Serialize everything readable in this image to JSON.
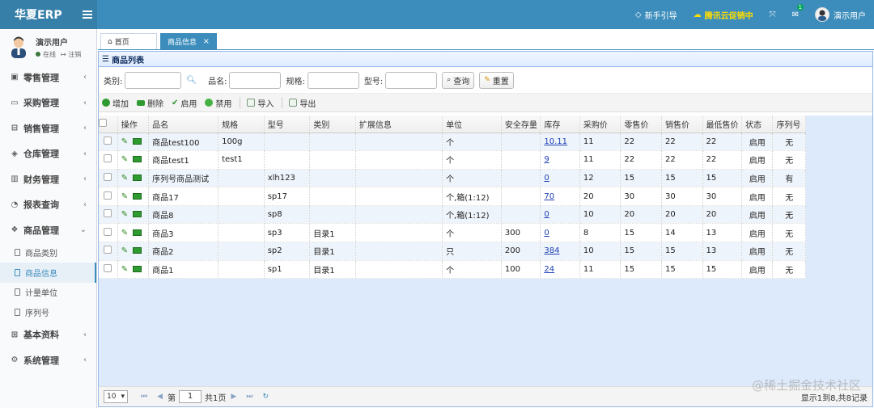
{
  "app": {
    "logo": "华夏ERP"
  },
  "topbar": {
    "guide": "新手引导",
    "promo": "腾讯云促销中",
    "mail_badge": "1",
    "user": "演示用户"
  },
  "sidebar": {
    "user_name": "演示用户",
    "status_online": "在线",
    "status_logout": "注销",
    "items": [
      {
        "label": "零售管理",
        "icon": "retail-icon"
      },
      {
        "label": "采购管理",
        "icon": "purchase-icon"
      },
      {
        "label": "销售管理",
        "icon": "sales-icon"
      },
      {
        "label": "仓库管理",
        "icon": "warehouse-icon"
      },
      {
        "label": "财务管理",
        "icon": "finance-icon"
      },
      {
        "label": "报表查询",
        "icon": "report-icon"
      },
      {
        "label": "商品管理",
        "icon": "goods-icon"
      }
    ],
    "subitems": [
      {
        "label": "商品类别"
      },
      {
        "label": "商品信息"
      },
      {
        "label": "计量单位"
      },
      {
        "label": "序列号"
      }
    ],
    "items_bottom": [
      {
        "label": "基本资料",
        "icon": "basic-icon"
      },
      {
        "label": "系统管理",
        "icon": "system-icon"
      }
    ]
  },
  "tabs": {
    "home": "首页",
    "active": "商品信息"
  },
  "panel": {
    "title": "商品列表"
  },
  "search": {
    "category_label": "类别:",
    "name_label": "品名:",
    "spec_label": "规格:",
    "model_label": "型号:",
    "query_button": "查询",
    "reset_button": "重置"
  },
  "toolbar": {
    "add": "增加",
    "delete": "删除",
    "enable": "启用",
    "disable": "禁用",
    "import": "导入",
    "export": "导出"
  },
  "table": {
    "headers": [
      "操作",
      "品名",
      "规格",
      "型号",
      "类别",
      "扩展信息",
      "单位",
      "安全存量",
      "库存",
      "采购价",
      "零售价",
      "销售价",
      "最低售价",
      "状态",
      "序列号"
    ],
    "rows": [
      {
        "name": "商品test100",
        "spec": "100g",
        "model": "",
        "category": "",
        "ext": "",
        "unit": "个",
        "safety": "",
        "stock": "10.11",
        "purchase": "11",
        "retail": "22",
        "sale": "22",
        "min": "22",
        "status": "启用",
        "serial": "无"
      },
      {
        "name": "商品test1",
        "spec": "test1",
        "model": "",
        "category": "",
        "ext": "",
        "unit": "个",
        "safety": "",
        "stock": "9",
        "purchase": "11",
        "retail": "22",
        "sale": "22",
        "min": "22",
        "status": "启用",
        "serial": "无"
      },
      {
        "name": "序列号商品测试",
        "spec": "",
        "model": "xlh123",
        "category": "",
        "ext": "",
        "unit": "个",
        "safety": "",
        "stock": "0",
        "purchase": "12",
        "retail": "15",
        "sale": "15",
        "min": "15",
        "status": "启用",
        "serial": "有"
      },
      {
        "name": "商品17",
        "spec": "",
        "model": "sp17",
        "category": "",
        "ext": "",
        "unit": "个,箱(1:12)",
        "safety": "",
        "stock": "70",
        "purchase": "20",
        "retail": "30",
        "sale": "30",
        "min": "30",
        "status": "启用",
        "serial": "无"
      },
      {
        "name": "商品8",
        "spec": "",
        "model": "sp8",
        "category": "",
        "ext": "",
        "unit": "个,箱(1:12)",
        "safety": "",
        "stock": "0",
        "purchase": "10",
        "retail": "20",
        "sale": "20",
        "min": "20",
        "status": "启用",
        "serial": "无"
      },
      {
        "name": "商品3",
        "spec": "",
        "model": "sp3",
        "category": "目录1",
        "ext": "",
        "unit": "个",
        "safety": "300",
        "stock": "0",
        "purchase": "8",
        "retail": "15",
        "sale": "14",
        "min": "13",
        "status": "启用",
        "serial": "无"
      },
      {
        "name": "商品2",
        "spec": "",
        "model": "sp2",
        "category": "目录1",
        "ext": "",
        "unit": "只",
        "safety": "200",
        "stock": "384",
        "purchase": "10",
        "retail": "15",
        "sale": "15",
        "min": "13",
        "status": "启用",
        "serial": "无"
      },
      {
        "name": "商品1",
        "spec": "",
        "model": "sp1",
        "category": "目录1",
        "ext": "",
        "unit": "个",
        "safety": "100",
        "stock": "24",
        "purchase": "11",
        "retail": "15",
        "sale": "15",
        "min": "15",
        "status": "启用",
        "serial": "无"
      }
    ]
  },
  "pager": {
    "page_size": "10",
    "page_prefix": "第",
    "page_value": "1",
    "page_suffix": "共1页",
    "info": "显示1到8,共8记录"
  },
  "watermark": "@稀土掘金技术社区"
}
